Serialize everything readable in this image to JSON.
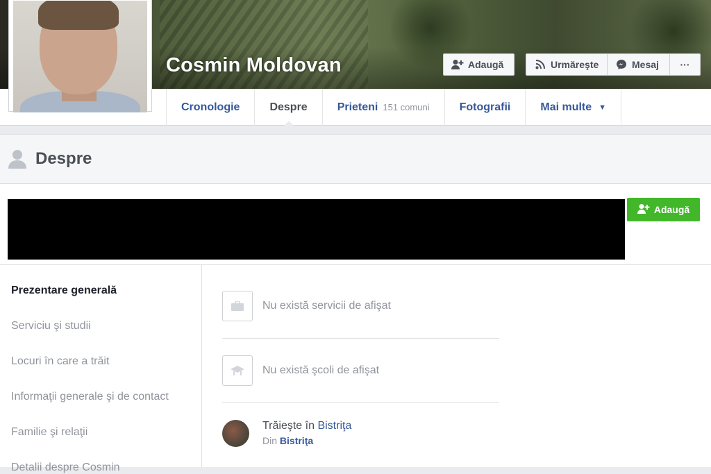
{
  "profile": {
    "name": "Cosmin Moldovan",
    "photo_tag": "SA"
  },
  "actions": {
    "add_label": "Adaugă",
    "follow_label": "Urmăreşte",
    "message_label": "Mesaj",
    "more_label": "···"
  },
  "nav": {
    "tabs": [
      {
        "label": "Cronologie",
        "active": false
      },
      {
        "label": "Despre",
        "active": true
      },
      {
        "label": "Prieteni",
        "sub": "151 comuni",
        "active": false
      },
      {
        "label": "Fotografii",
        "active": false
      },
      {
        "label": "Mai multe",
        "active": false
      }
    ],
    "more_caret": "▼"
  },
  "section": {
    "title": "Despre",
    "add_button_label": "Adaugă"
  },
  "sidebar": {
    "items": [
      {
        "label": "Prezentare generală",
        "active": true
      },
      {
        "label": "Serviciu şi studii",
        "active": false
      },
      {
        "label": "Locuri în care a trăit",
        "active": false
      },
      {
        "label": "Informaţii generale şi de contact",
        "active": false
      },
      {
        "label": "Familie şi relaţii",
        "active": false
      },
      {
        "label": "Detalii despre Cosmin",
        "active": false
      }
    ]
  },
  "overview": {
    "work_text": "Nu există servicii de afişat",
    "school_text": "Nu există şcoli de afişat",
    "lives_prefix": "Trăieşte în ",
    "lives_city": "Bistriţa",
    "from_prefix": "Din ",
    "from_city": "Bistriţa"
  },
  "colors": {
    "link": "#365899",
    "green": "#42b72a",
    "muted": "#90949c"
  }
}
